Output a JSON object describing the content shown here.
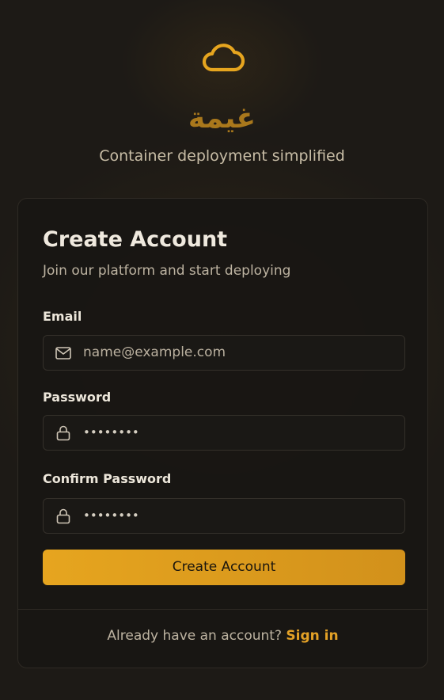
{
  "brand": {
    "logo_icon": "cloud-icon",
    "name": "غيمة",
    "tagline": "Container deployment simplified",
    "accent_color": "#e6a51f"
  },
  "card": {
    "title": "Create Account",
    "subtitle": "Join our platform and start deploying",
    "email": {
      "label": "Email",
      "icon": "mail-icon",
      "placeholder": "name@example.com"
    },
    "password": {
      "label": "Password",
      "icon": "lock-icon",
      "value": "••••••••"
    },
    "confirm_password": {
      "label": "Confirm Password",
      "icon": "lock-icon",
      "value": "••••••••"
    },
    "submit_label": "Create Account",
    "footer_text": "Already have an account?",
    "signin_label": "Sign in"
  }
}
